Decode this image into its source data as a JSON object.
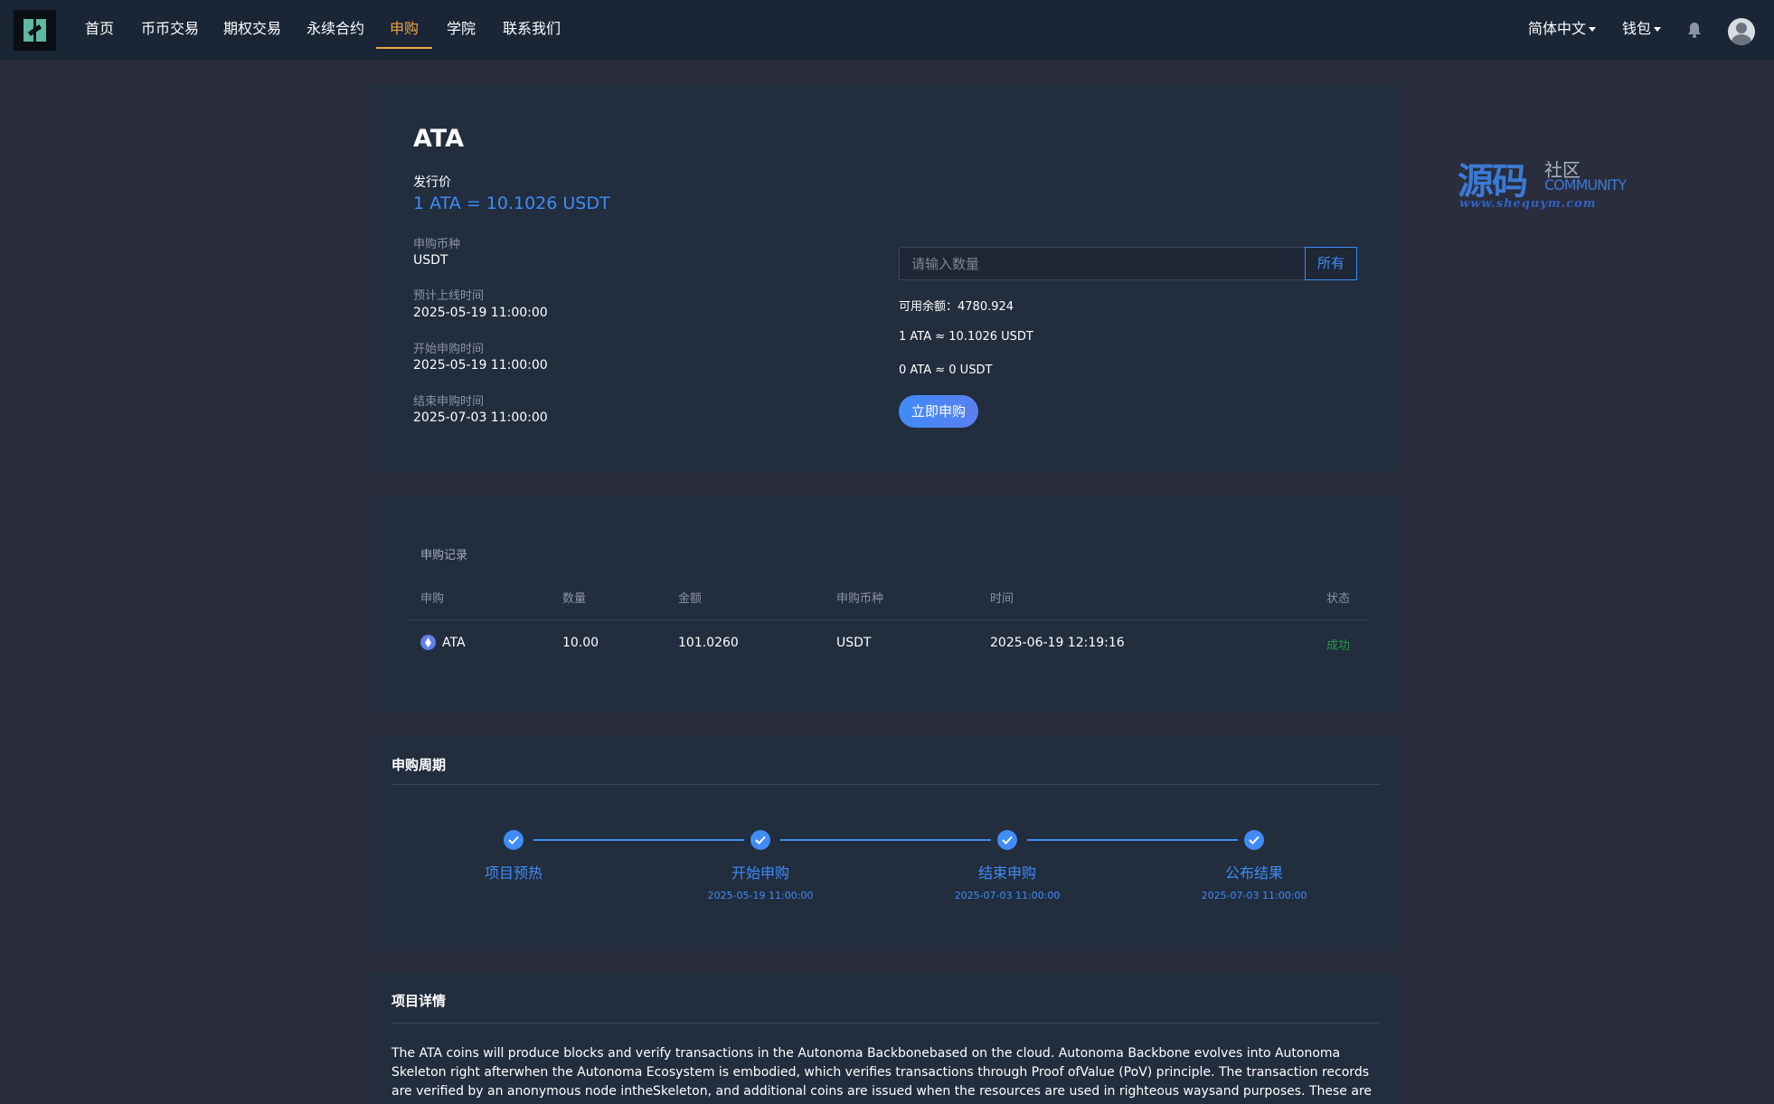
{
  "nav": {
    "items": [
      {
        "label": "首页"
      },
      {
        "label": "币币交易"
      },
      {
        "label": "期权交易"
      },
      {
        "label": "永续合约"
      },
      {
        "label": "申购"
      },
      {
        "label": "学院"
      },
      {
        "label": "联系我们"
      }
    ],
    "active_label": "申购",
    "language": "简体中文",
    "wallet": "钱包"
  },
  "subscribe": {
    "coin": "ATA",
    "price_label": "发行价",
    "price": "1 ATA = 10.1026 USDT",
    "fields": [
      {
        "label": "申购币种",
        "value": "USDT"
      },
      {
        "label": "预计上线时间",
        "value": "2025-05-19 11:00:00"
      },
      {
        "label": "开始申购时间",
        "value": "2025-05-19 11:00:00"
      },
      {
        "label": "结束申购时间",
        "value": "2025-07-03 11:00:00"
      }
    ],
    "input_placeholder": "请输入数量",
    "all_label": "所有",
    "balance": "可用余额：4780.924",
    "rate": "1 ATA ≈ 10.1026 USDT",
    "estimate": "0 ATA ≈ 0 USDT",
    "submit_label": "立即申购"
  },
  "records": {
    "title": "申购记录",
    "headers": [
      "申购",
      "数量",
      "金额",
      "申购币种",
      "时间",
      "状态"
    ],
    "rows": [
      {
        "coin": "ATA",
        "qty": "10.00",
        "amount": "101.0260",
        "currency": "USDT",
        "time": "2025-06-19 12:19:16",
        "status": "成功"
      }
    ]
  },
  "cycle": {
    "title": "申购周期",
    "steps": [
      {
        "name": "项目预热",
        "date": ""
      },
      {
        "name": "开始申购",
        "date": "2025-05-19 11:00:00"
      },
      {
        "name": "结束申购",
        "date": "2025-07-03 11:00:00"
      },
      {
        "name": "公布结果",
        "date": "2025-07-03 11:00:00"
      }
    ]
  },
  "details": {
    "title": "项目详情",
    "text": "The ATA coins will produce blocks and verify transactions in the Autonoma Backbonebased on the cloud. Autonoma Backbone evolves into Autonoma Skeleton right afterwhen the Autonoma Ecosystem is embodied, which verifies transactions through Proof ofValue (PoV) principle. The transaction records are verified by an anonymous node intheSkeleton, and additional coins are issued when the resources are used in righteous waysand purposes. These are for rewarding the realization of"
  },
  "watermark": {
    "big": "源码",
    "she": "社区",
    "com": "COMMUNITY",
    "url": "www.shequym.com"
  },
  "colors": {
    "accent": "#3f8cf7",
    "active_nav": "#f0a540",
    "success": "#1f9d3f",
    "card_bg": "#222d3e",
    "page_bg": "#2a2d3c"
  }
}
